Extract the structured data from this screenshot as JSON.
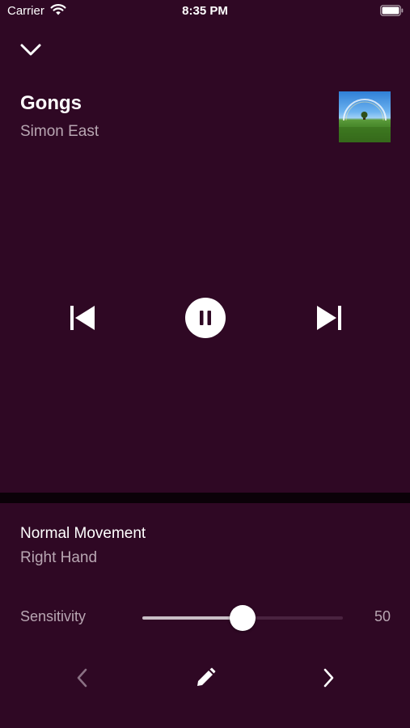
{
  "status_bar": {
    "carrier": "Carrier",
    "time": "8:35 PM",
    "icons": [
      "wifi-icon",
      "battery-icon"
    ]
  },
  "player": {
    "collapse_icon": "chevron-down-icon",
    "title": "Gongs",
    "artist": "Simon East",
    "album_art": "landscape-with-rainbow",
    "controls": {
      "previous_icon": "skip-previous-icon",
      "play_pause_icon": "pause-icon",
      "next_icon": "skip-next-icon",
      "state": "playing"
    }
  },
  "movement": {
    "title": "Normal Movement",
    "subtitle": "Right Hand"
  },
  "sensitivity": {
    "label": "Sensitivity",
    "value": "50",
    "min": 0,
    "max": 100,
    "level": 50
  },
  "bottom_nav": {
    "prev_icon": "chevron-left-icon",
    "edit_icon": "pencil-icon",
    "next_icon": "chevron-right-icon"
  },
  "colors": {
    "background": "#2f0824",
    "divider": "#0b0108",
    "secondary_text": "#b8a6b2",
    "primary_text": "#ffffff"
  }
}
